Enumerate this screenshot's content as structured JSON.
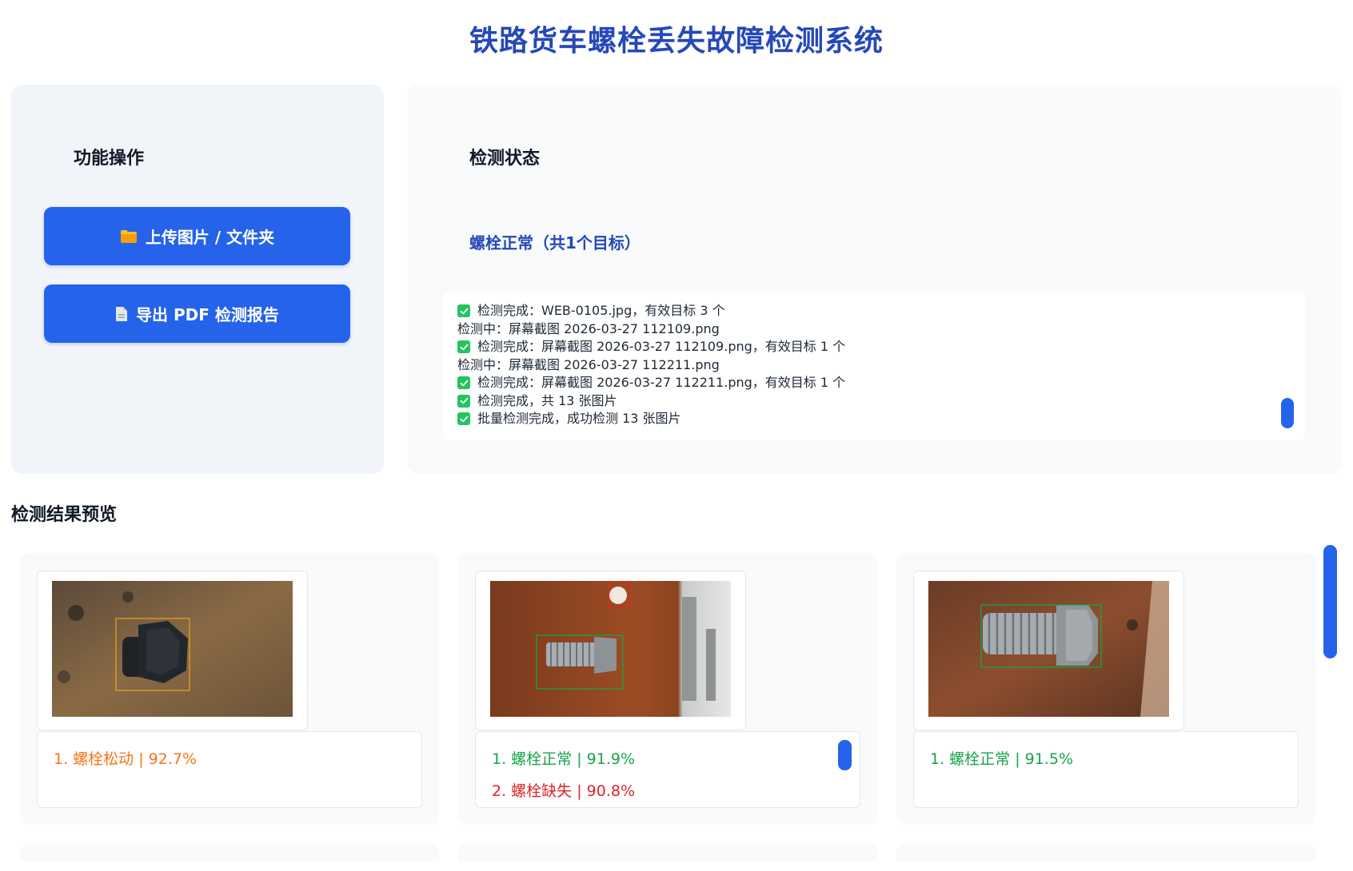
{
  "app": {
    "title": "铁路货车螺栓丢失故障检测系统"
  },
  "controls": {
    "title": "功能操作",
    "upload_label": "上传图片 / 文件夹",
    "upload_icon": "folder-icon",
    "export_label": "导出 PDF 检测报告",
    "export_icon": "document-icon"
  },
  "status": {
    "title": "检测状态",
    "summary": "螺栓正常（共1个目标）",
    "log": [
      {
        "check": true,
        "text": "检测完成：WEB-0105.jpg，有效目标 3 个"
      },
      {
        "check": false,
        "text": "检测中：屏幕截图 2026-03-27 112109.png"
      },
      {
        "check": true,
        "text": "检测完成：屏幕截图 2026-03-27 112109.png，有效目标 1 个"
      },
      {
        "check": false,
        "text": "检测中：屏幕截图 2026-03-27 112211.png"
      },
      {
        "check": true,
        "text": "检测完成：屏幕截图 2026-03-27 112211.png，有效目标 1 个"
      },
      {
        "check": true,
        "text": "检测完成，共 13 张图片"
      },
      {
        "check": true,
        "text": "批量检测完成，成功检测 13 张图片"
      }
    ]
  },
  "results": {
    "title": "检测结果预览",
    "colors": {
      "loose": "#f97316",
      "normal": "#16a34a",
      "missing": "#dc2626",
      "accent": "#2563eb"
    },
    "cards": [
      {
        "items": [
          {
            "text": "1. 螺栓松动 | 92.7%",
            "kind": "loose"
          }
        ]
      },
      {
        "items": [
          {
            "text": "1. 螺栓正常 | 91.9%",
            "kind": "normal"
          },
          {
            "text": "2. 螺栓缺失 | 90.8%",
            "kind": "missing"
          }
        ]
      },
      {
        "items": [
          {
            "text": "1. 螺栓正常 | 91.5%",
            "kind": "normal"
          }
        ]
      }
    ]
  }
}
